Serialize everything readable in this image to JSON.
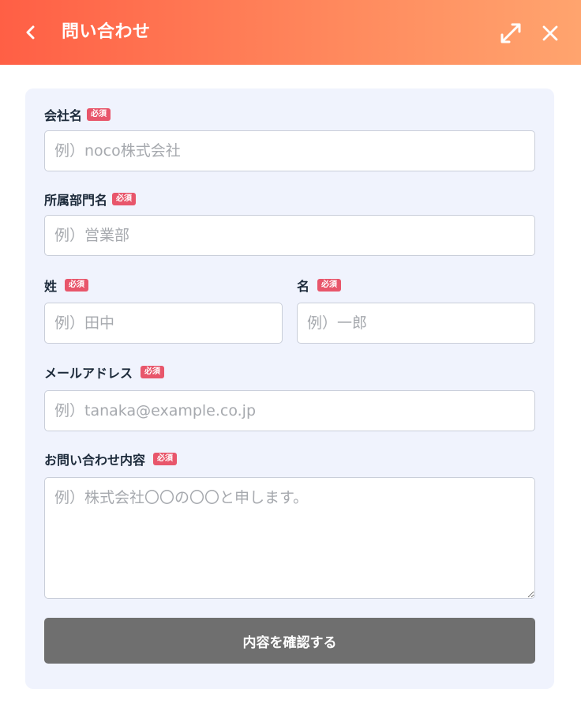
{
  "header": {
    "title": "問い合わせ",
    "back_icon": "chevron-left-icon",
    "expand_icon": "expand-icon",
    "close_icon": "close-icon"
  },
  "required_badge": "必須",
  "form": {
    "company": {
      "label": "会社名",
      "placeholder": "例）noco株式会社"
    },
    "department": {
      "label": "所属部門名",
      "placeholder": "例）営業部"
    },
    "last_name": {
      "label": "姓",
      "placeholder": "例）田中"
    },
    "first_name": {
      "label": "名",
      "placeholder": "例）一郎"
    },
    "email": {
      "label": "メールアドレス",
      "placeholder": "例）tanaka@example.co.jp"
    },
    "message": {
      "label": "お問い合わせ内容",
      "placeholder": "例）株式会社〇〇の〇〇と申します。"
    },
    "submit_label": "内容を確認する"
  },
  "colors": {
    "header_gradient_start": "#ff5f45",
    "header_gradient_end": "#ffa46e",
    "required_badge": "#e8566b",
    "card_background": "#f0f3fd",
    "submit_button": "#6f6f6f"
  }
}
